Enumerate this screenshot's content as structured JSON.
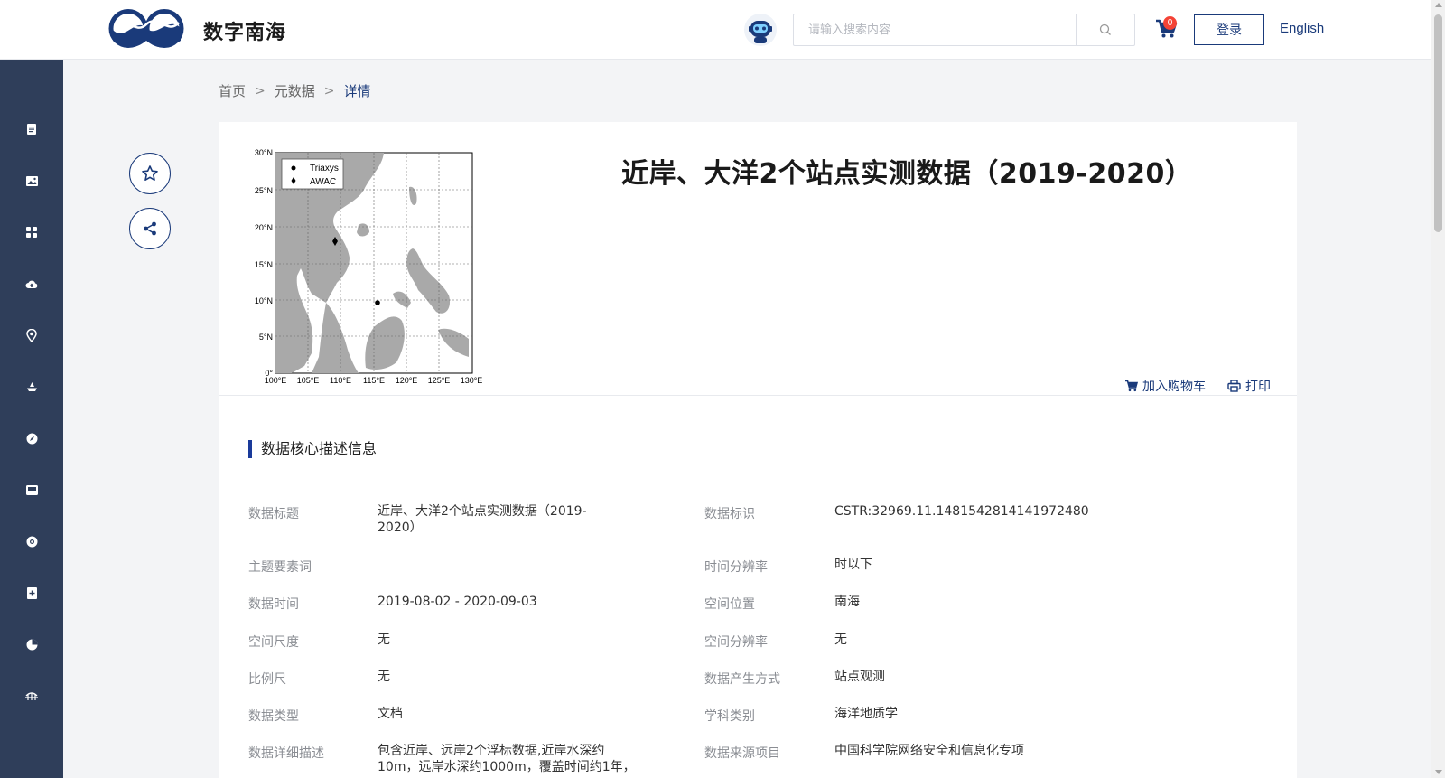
{
  "header": {
    "site_name": "数字南海",
    "search_placeholder": "请输入搜索内容",
    "cart_count": "0",
    "login_label": "登录",
    "lang_label": "English"
  },
  "breadcrumb": {
    "home": "首页",
    "metadata": "元数据",
    "current": "详情"
  },
  "detail": {
    "title": "近岸、大洋2个站点实测数据（2019-2020）",
    "add_to_cart": "加入购物车",
    "print": "打印",
    "section_title": "数据核心描述信息"
  },
  "map": {
    "legend": [
      "Triaxys",
      "AWAC"
    ],
    "lat_ticks": [
      "30°N",
      "25°N",
      "20°N",
      "15°N",
      "10°N",
      "5°N",
      "0°"
    ],
    "lon_ticks": [
      "100°E",
      "105°E",
      "110°E",
      "115°E",
      "120°E",
      "125°E",
      "130°E"
    ]
  },
  "fields_left": [
    {
      "label": "数据标题",
      "value": "近岸、大洋2个站点实测数据（2019-",
      "value2": "2020）"
    },
    {
      "label": "主题要素词",
      "value": ""
    },
    {
      "label": "数据时间",
      "value": "2019-08-02 - 2020-09-03"
    },
    {
      "label": "空间尺度",
      "value": "无"
    },
    {
      "label": "比例尺",
      "value": "无"
    },
    {
      "label": "数据类型",
      "value": "文档"
    },
    {
      "label": "数据详细描述",
      "value": "包含近岸、远岸2个浮标数据,近岸水深约",
      "value2": "10m，远岸水深约1000m，覆盖时间约1年，"
    }
  ],
  "fields_right": [
    {
      "label": "数据标识",
      "value": "CSTR:32969.11.1481542814141972480"
    },
    {
      "label": "时间分辨率",
      "value": "时以下"
    },
    {
      "label": "空间位置",
      "value": "南海"
    },
    {
      "label": "空间分辨率",
      "value": "无"
    },
    {
      "label": "数据产生方式",
      "value": "站点观测"
    },
    {
      "label": "学科类别",
      "value": "海洋地质学"
    },
    {
      "label": "数据来源项目",
      "value": "中国科学院网络安全和信息化专项"
    }
  ],
  "sidebar_icons": [
    "document-icon",
    "image-icon",
    "grid-icon",
    "cloud-upload-icon",
    "location-icon",
    "ship-icon",
    "compass-icon",
    "inbox-icon",
    "lifebuoy-icon",
    "add-file-icon",
    "pie-chart-icon",
    "bridge-icon"
  ]
}
